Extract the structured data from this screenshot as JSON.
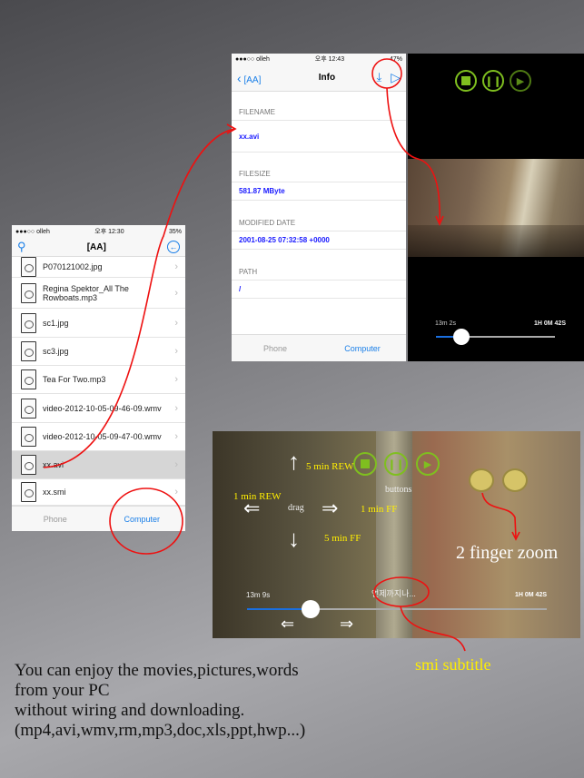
{
  "list_screen": {
    "status": {
      "carrier": "●●●○○ olleh",
      "time": "오후 12:30",
      "battery": "35%"
    },
    "title": "[AA]",
    "files": [
      {
        "name": "P070121002.jpg",
        "icon": "image-file-icon"
      },
      {
        "name": "Regina Spektor_All The Rowboats.mp3",
        "icon": "audio-file-icon"
      },
      {
        "name": "sc1.jpg",
        "icon": "image-file-icon"
      },
      {
        "name": "sc3.jpg",
        "icon": "image-file-icon"
      },
      {
        "name": "Tea For Two.mp3",
        "icon": "audio-file-icon"
      },
      {
        "name": "video-2012-10-05-09-46-09.wmv",
        "icon": "video-file-icon"
      },
      {
        "name": "video-2012-10-05-09-47-00.wmv",
        "icon": "video-file-icon"
      },
      {
        "name": "xx.avi",
        "icon": "video-file-icon",
        "selected": true
      },
      {
        "name": "xx.smi",
        "icon": "document-file-icon"
      }
    ],
    "tabs": {
      "phone": "Phone",
      "computer": "Computer"
    }
  },
  "info_screen": {
    "status": {
      "carrier": "●●●○○ olleh",
      "time": "오후 12:43",
      "battery": "47%"
    },
    "back": "[AA]",
    "title": "Info",
    "filename_label": "FILENAME",
    "filename": "xx.avi",
    "filesize_label": "FILESIZE",
    "filesize": "581.87 MByte",
    "modified_label": "MODIFIED DATE",
    "modified": "2001-08-25 07:32:58 +0000",
    "path_label": "PATH",
    "path": "/",
    "tabs": {
      "phone": "Phone",
      "computer": "Computer"
    }
  },
  "player": {
    "elapsed": "13m 2s",
    "total": "1H 0M 42S",
    "progress": 0.21,
    "accent": "#7fbf1f"
  },
  "landscape": {
    "elapsed": "13m 9s",
    "total": "1H 0M 42S",
    "progress": 0.21,
    "subtitle": "언제까지나...",
    "labels": {
      "rew5": "5 min REW",
      "rew1": "1 min REW",
      "ff1": "1 min FF",
      "ff5": "5 min FF",
      "drag": "drag",
      "buttons": "buttons",
      "zoom": "2 finger zoom",
      "smi": "smi subtitle"
    }
  },
  "caption": [
    "You can enjoy the movies,pictures,words",
    "from your PC",
    "without wiring and downloading.",
    "(mp4,avi,wmv,rm,mp3,doc,xls,ppt,hwp...)"
  ],
  "annotation_color": "#ee1111"
}
